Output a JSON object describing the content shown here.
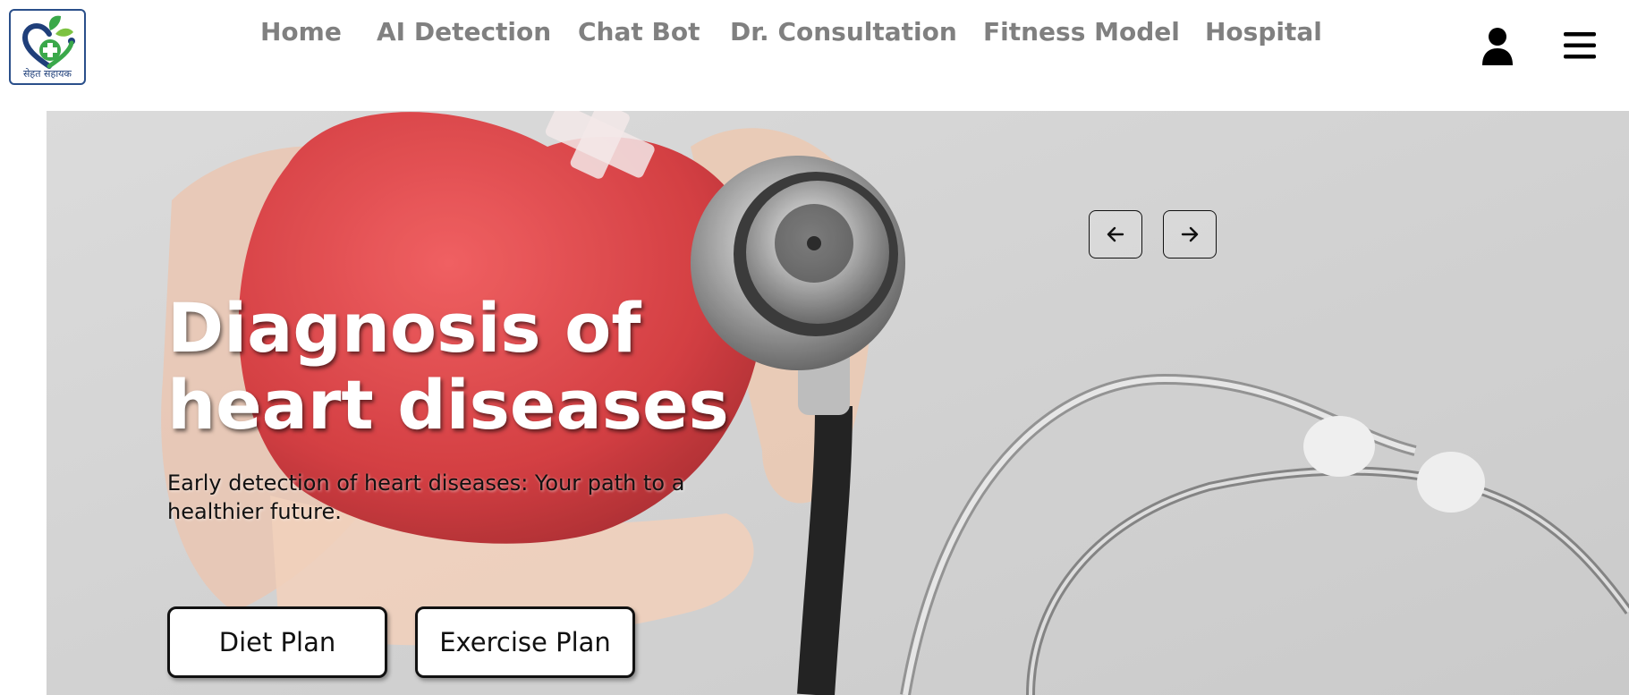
{
  "logo": {
    "text": "सेहत सहायक",
    "icon": "heart-cross-logo-icon"
  },
  "nav": {
    "items": [
      {
        "label": "Home"
      },
      {
        "label": "AI Detection"
      },
      {
        "label": "Chat Bot"
      },
      {
        "label": "Dr. Consultation"
      },
      {
        "label": "Fitness Model"
      },
      {
        "label": "Hospital"
      }
    ]
  },
  "header_icons": {
    "user": "user-icon",
    "menu": "hamburger-menu-icon"
  },
  "hero": {
    "title": "Diagnosis of heart diseases",
    "subtitle": "Early detection of heart diseases: Your path to a healthier future.",
    "buttons": {
      "diet": "Diet Plan",
      "exercise": "Exercise Plan"
    },
    "carousel": {
      "prev_icon": "arrow-left-icon",
      "next_icon": "arrow-right-icon"
    }
  },
  "colors": {
    "nav_text": "#808080",
    "logo_border": "#2a4f8a",
    "logo_green": "#3aa84a",
    "logo_blue": "#1f3f7a",
    "heart_red": "#d9373a"
  }
}
